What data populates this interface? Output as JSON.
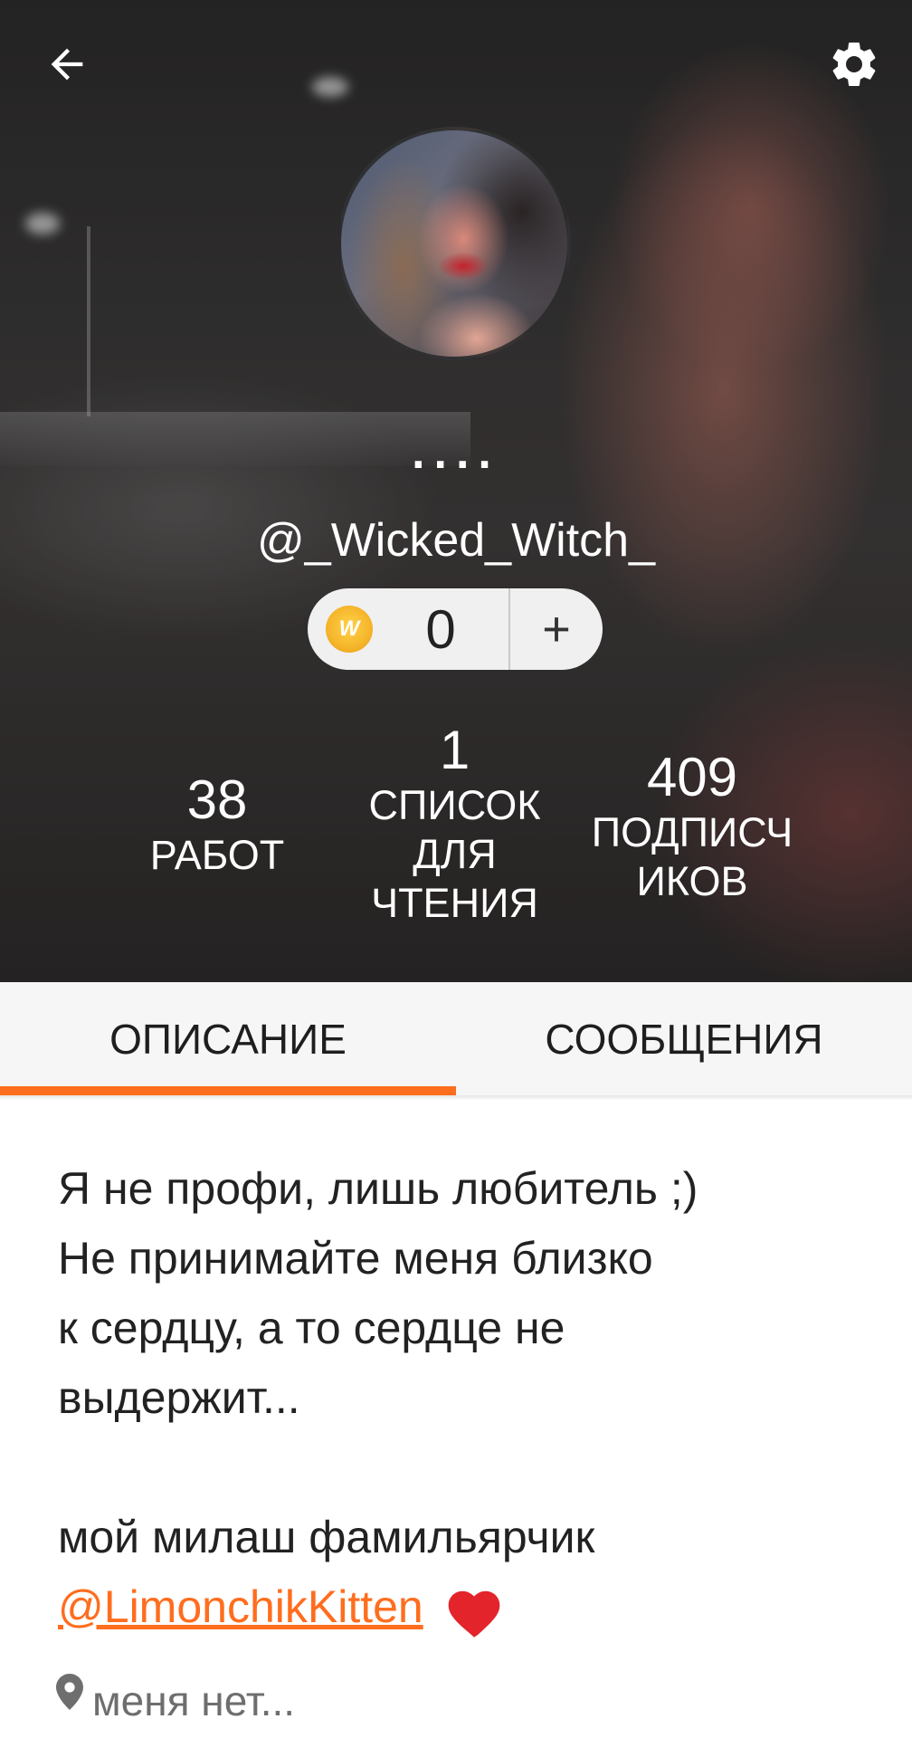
{
  "header": {
    "display_name": "....",
    "username": "@_Wicked_Witch_",
    "coins": {
      "count": "0",
      "add_label": "+"
    }
  },
  "stats": {
    "works": {
      "value": "38",
      "label": "РАБОТ"
    },
    "reading_lists": {
      "value": "1",
      "label_line1": "СПИСОК",
      "label_line2": "ДЛЯ",
      "label_line3": "ЧТЕНИЯ"
    },
    "followers": {
      "value": "409",
      "label_line1": "ПОДПИСЧ",
      "label_line2": "ИКОВ"
    }
  },
  "tabs": [
    {
      "label": "ОПИСАНИЕ",
      "active": true
    },
    {
      "label": "СООБЩЕНИЯ",
      "active": false
    }
  ],
  "about": {
    "line1": "Я не профи, лишь любитель ;)",
    "line2": "Не принимайте меня близко",
    "line3": "к сердцу, а то сердце не",
    "line4": "выдержит...",
    "line5": "мой милаш фамильярчик",
    "mention": "@LimonchikKitten"
  },
  "location": "меня нет...",
  "colors": {
    "accent": "#ff6d1e",
    "coin": "#f5b52a",
    "heart": "#e3242b"
  },
  "icons": [
    "arrow-left-icon",
    "gear-icon",
    "coin-icon",
    "location-pin-icon",
    "heart-icon"
  ]
}
